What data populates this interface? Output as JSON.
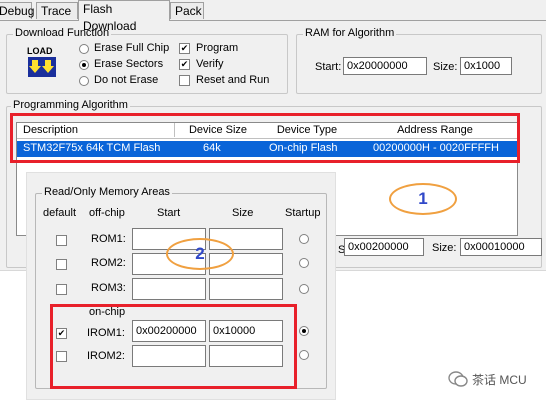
{
  "tabs": [
    "Debug",
    "Trace",
    "Flash Download",
    "Pack"
  ],
  "download_function": {
    "title": "Download Function",
    "load_icon_text": "LOAD",
    "erase_options": [
      "Erase Full Chip",
      "Erase Sectors",
      "Do not Erase"
    ],
    "erase_selected": "Erase Sectors",
    "checks": [
      {
        "label": "Program",
        "checked": true
      },
      {
        "label": "Verify",
        "checked": true
      },
      {
        "label": "Reset and Run",
        "checked": false
      }
    ]
  },
  "ram": {
    "title": "RAM for Algorithm",
    "start_label": "Start:",
    "start_value": "0x20000000",
    "size_label": "Size:",
    "size_value": "0x1000"
  },
  "programming_algorithm": {
    "title": "Programming Algorithm",
    "columns": [
      "Description",
      "Device Size",
      "Device Type",
      "Address Range"
    ],
    "row": {
      "description": "STM32F75x 64k TCM Flash",
      "size": "64k",
      "type": "On-chip Flash",
      "range": "00200000H - 0020FFFFH"
    },
    "start_label": "Start:",
    "start_value": "0x00200000",
    "size_label": "Size:",
    "size_value": "0x00010000"
  },
  "memory_areas": {
    "title": "Read/Only Memory Areas",
    "headers": {
      "default": "default",
      "offchip": "off-chip",
      "start": "Start",
      "size": "Size",
      "startup": "Startup"
    },
    "offchip_rows": [
      {
        "name": "ROM1:",
        "start": "",
        "size": ""
      },
      {
        "name": "ROM2:",
        "start": "",
        "size": ""
      },
      {
        "name": "ROM3:",
        "start": "",
        "size": ""
      }
    ],
    "onchip_label": "on-chip",
    "onchip_rows": [
      {
        "name": "IROM1:",
        "start": "0x00200000",
        "size": "0x10000",
        "default": true,
        "startup": true
      },
      {
        "name": "IROM2:",
        "start": "",
        "size": "",
        "default": false,
        "startup": false
      }
    ]
  },
  "annotations": {
    "one": "1",
    "two": "2"
  },
  "watermark": "茶话 MCU",
  "colors": {
    "selection": "#0a64d8",
    "highlight_box": "#e8202a",
    "ellipse": "#f0a040",
    "number": "#3048c8"
  }
}
